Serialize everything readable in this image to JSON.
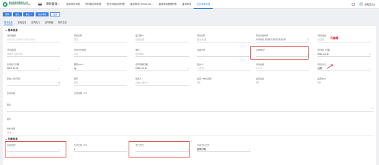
{
  "header": {
    "logo_line1": "建设投资有限责任公司",
    "logo_line2": "CONSTRUCTION INVESTMENT",
    "nav_title": "采购管理",
    "nav_title_chevron": "∨",
    "tabs": [
      "建设申请列表",
      "预付款合同列表",
      "进行清款合同列表",
      "建设申请YG0101-RZ...",
      "建设申请数据列表",
      "建设申请",
      "企业清款合同"
    ],
    "active_tab_index": 6,
    "user_name": "采购员(03)"
  },
  "toolbar": {
    "buttons": [
      "保存",
      "提交",
      "提交 ∨",
      "提交审核",
      "更多"
    ]
  },
  "subtabs": {
    "items": [
      "基本信息",
      "费用信息",
      "合同执行",
      "合同明细",
      "附件信息"
    ],
    "active_index": 0
  },
  "section_basic": {
    "title": "基本信息"
  },
  "section_pay": {
    "title": "付款信息"
  },
  "fields": {
    "contract_no": {
      "label": "合同编码",
      "required": true,
      "value": "YG0101-QTKHT-2022-0001",
      "muted": true
    },
    "project_name": {
      "label": "项目名称",
      "value": ""
    },
    "ledger": {
      "label": "签订账户",
      "value": "建设资源",
      "muted": true
    },
    "pay_account": {
      "label": "项目名称",
      "value": "建设资源",
      "muted": true
    },
    "apply_no": {
      "label": "申请采购单号",
      "value": "YG0101-RZ202-202212-0076"
    },
    "org": {
      "label": "项目组织",
      "required": true,
      "value": "请选择",
      "muted": true
    },
    "contract_name": {
      "label": "合同名称",
      "required": true,
      "value": "请输入合同名称",
      "muted": true
    },
    "sign_type": {
      "label": "付款方式类型",
      "value": "合同",
      "muted": true
    },
    "unit": {
      "label": "单位",
      "value": "建设单位",
      "muted": true
    },
    "purchase_way": {
      "label": "采购方式",
      "value": ""
    },
    "main_unit": {
      "label": "主体单位",
      "required": true,
      "value": ""
    },
    "start_date_label": {
      "label": "合同签订日期",
      "value": "2022-12-11"
    },
    "sign_date": {
      "label": "合同签订日期",
      "value": "2022-12-11"
    },
    "valid_period": {
      "label": "期限(year)",
      "value": "1y"
    },
    "end_date": {
      "label": "合同到期日期",
      "value": "2023-12-11"
    },
    "owner": {
      "label": "经办人",
      "required": true,
      "value": "人员列",
      "muted": true
    },
    "amount": {
      "label": "清款金额",
      "value": "¥ 0.00",
      "muted": true
    },
    "currency": {
      "label": "清款方式",
      "value": "分期"
    },
    "approver": {
      "label": "审批人员(已审)",
      "value": ""
    },
    "tax_rate": {
      "label": "税率",
      "value": ""
    },
    "contact": {
      "label": "联系人",
      "value": "请输入联系人",
      "muted": true
    },
    "is_core": {
      "label": "是否一体化采购",
      "value": ""
    },
    "is_approved": {
      "label": "是否会签",
      "value": ""
    },
    "is_rent": {
      "label": "是否支付",
      "value": ""
    },
    "amount_words": {
      "label": "合同金额",
      "value": ""
    },
    "ratio": {
      "label": "合同金额（%）",
      "value": ""
    },
    "remark": {
      "label": "备注",
      "value": ""
    },
    "attachment": {
      "label": "附件",
      "value": ""
    },
    "memo": {
      "label": "附件说明",
      "value": ""
    },
    "pay_type": {
      "label": "付款类型",
      "required": true,
      "value": ""
    },
    "pay_ratio": {
      "label": "支付比例（%）",
      "value": "0"
    },
    "pay_way": {
      "label": "支付方式",
      "value": ""
    },
    "pay_org": {
      "label": "付款支付方式",
      "value": "按期付款"
    }
  },
  "annotation": {
    "note": "可编辑"
  },
  "colors": {
    "accent": "#2b78e4",
    "brand": "#1fa463",
    "highlight": "#e04444"
  }
}
